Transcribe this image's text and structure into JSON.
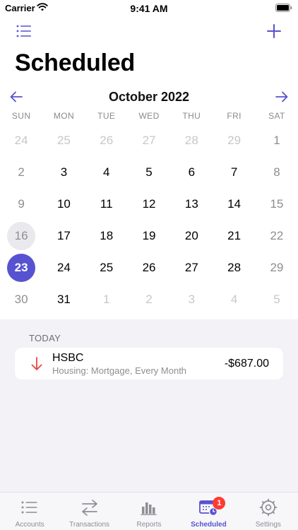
{
  "status_bar": {
    "carrier": "Carrier",
    "time": "9:41 AM"
  },
  "page": {
    "title": "Scheduled"
  },
  "calendar": {
    "month_label": "October 2022",
    "weekdays": [
      "SUN",
      "MON",
      "TUE",
      "WED",
      "THU",
      "FRI",
      "SAT"
    ],
    "days": [
      {
        "n": "24",
        "state": "out"
      },
      {
        "n": "25",
        "state": "out"
      },
      {
        "n": "26",
        "state": "out"
      },
      {
        "n": "27",
        "state": "out"
      },
      {
        "n": "28",
        "state": "out"
      },
      {
        "n": "29",
        "state": "out"
      },
      {
        "n": "1",
        "state": "weekend"
      },
      {
        "n": "2",
        "state": "weekend"
      },
      {
        "n": "3",
        "state": "in"
      },
      {
        "n": "4",
        "state": "in"
      },
      {
        "n": "5",
        "state": "in"
      },
      {
        "n": "6",
        "state": "in"
      },
      {
        "n": "7",
        "state": "in"
      },
      {
        "n": "8",
        "state": "weekend"
      },
      {
        "n": "9",
        "state": "weekend"
      },
      {
        "n": "10",
        "state": "in"
      },
      {
        "n": "11",
        "state": "in"
      },
      {
        "n": "12",
        "state": "in"
      },
      {
        "n": "13",
        "state": "in"
      },
      {
        "n": "14",
        "state": "in"
      },
      {
        "n": "15",
        "state": "weekend"
      },
      {
        "n": "16",
        "state": "today"
      },
      {
        "n": "17",
        "state": "in"
      },
      {
        "n": "18",
        "state": "in"
      },
      {
        "n": "19",
        "state": "in"
      },
      {
        "n": "20",
        "state": "in"
      },
      {
        "n": "21",
        "state": "in"
      },
      {
        "n": "22",
        "state": "weekend"
      },
      {
        "n": "23",
        "state": "selected"
      },
      {
        "n": "24",
        "state": "in"
      },
      {
        "n": "25",
        "state": "in"
      },
      {
        "n": "26",
        "state": "in"
      },
      {
        "n": "27",
        "state": "in"
      },
      {
        "n": "28",
        "state": "in"
      },
      {
        "n": "29",
        "state": "weekend"
      },
      {
        "n": "30",
        "state": "weekend"
      },
      {
        "n": "31",
        "state": "in"
      },
      {
        "n": "1",
        "state": "out"
      },
      {
        "n": "2",
        "state": "out"
      },
      {
        "n": "3",
        "state": "out"
      },
      {
        "n": "4",
        "state": "out"
      },
      {
        "n": "5",
        "state": "out"
      }
    ]
  },
  "schedule": {
    "section_header": "TODAY",
    "items": [
      {
        "name": "HSBC",
        "detail": "Housing: Mortgage, Every Month",
        "amount": "-$687.00",
        "direction": "outflow"
      }
    ]
  },
  "tab_bar": {
    "tabs": [
      {
        "label": "Accounts",
        "icon": "list-icon"
      },
      {
        "label": "Transactions",
        "icon": "arrows-swap-icon"
      },
      {
        "label": "Reports",
        "icon": "bar-chart-icon"
      },
      {
        "label": "Scheduled",
        "icon": "calendar-clock-icon",
        "active": true,
        "badge": "1"
      },
      {
        "label": "Settings",
        "icon": "gear-icon"
      }
    ]
  },
  "colors": {
    "accent": "#5752d0",
    "outflow": "#e8453c",
    "badge": "#ff3b30",
    "muted": "#8e8e93"
  }
}
